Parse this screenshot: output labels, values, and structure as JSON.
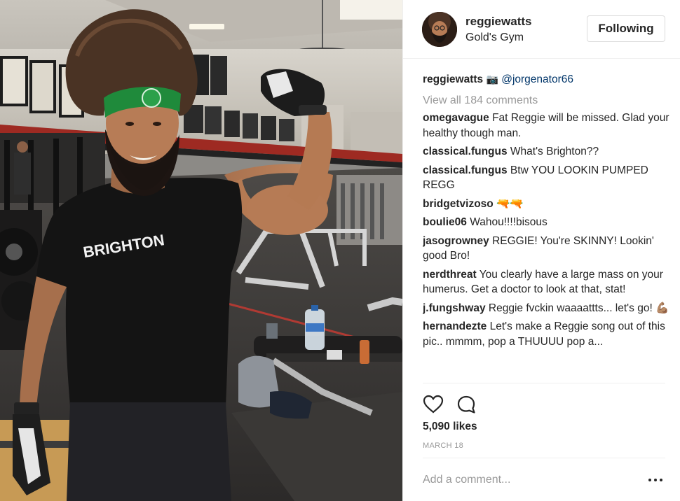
{
  "post": {
    "username": "reggiewatts",
    "location": "Gold's Gym",
    "follow_label": "Following",
    "shirt_text": "BRIGHTON",
    "caption": {
      "username": "reggiewatts",
      "camera_glyph": "📷",
      "mention": "@jorgenator66"
    },
    "view_all": "View all 184 comments",
    "comments": [
      {
        "user": "omegavague",
        "text": "Fat Reggie will be missed. Glad your healthy though man."
      },
      {
        "user": "classical.fungus",
        "text": "What's Brighton??"
      },
      {
        "user": "classical.fungus",
        "text": "Btw YOU LOOKIN PUMPED REGG"
      },
      {
        "user": "bridgetvizoso",
        "text": "🔫🔫"
      },
      {
        "user": "boulie06",
        "text": "Wahou!!!!bisous"
      },
      {
        "user": "jasogrowney",
        "text": "REGGIE! You're SKINNY! Lookin' good Bro!"
      },
      {
        "user": "nerdthreat",
        "text": "You clearly have a large mass on your humerus. Get a doctor to look at that, stat!"
      },
      {
        "user": "j.fungshway",
        "text": "Reggie fvckin waaaattts... let's go! 💪🏽"
      },
      {
        "user": "hernandezte",
        "text": "Let's make a Reggie song out of this pic.. mmmm, pop a THUUUU pop a..."
      }
    ],
    "likes": "5,090 likes",
    "date": "MARCH 18",
    "add_comment_placeholder": "Add a comment...",
    "icons": [
      "heart-icon",
      "comment-icon",
      "more-options-icon"
    ]
  }
}
